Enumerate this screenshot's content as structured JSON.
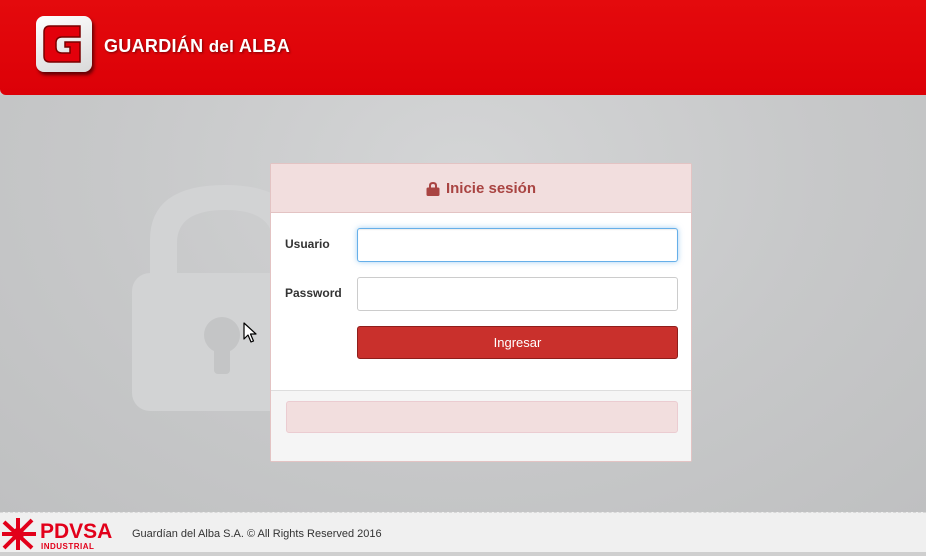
{
  "header": {
    "brand_name": "GUARDIÁN",
    "brand_del": "del",
    "brand_alba": "ALBA",
    "logo_icon": "guardian-g-logo"
  },
  "login": {
    "title": "Inicie sesión",
    "title_icon": "lock-icon",
    "username_label": "Usuario",
    "username_value": "",
    "password_label": "Password",
    "password_value": "",
    "submit_label": "Ingresar",
    "alert_message": ""
  },
  "background": {
    "watermark_icon": "lock-icon"
  },
  "footer": {
    "logo_text": "PDVSA",
    "logo_subtext": "INDUSTRIAL",
    "copyright": "Guardían del Alba S.A. © All Rights Reserved 2016"
  },
  "colors": {
    "header_red": "#e40a0d",
    "panel_heading_bg": "#f2dede",
    "panel_heading_text": "#a94442",
    "button_red": "#c9302c",
    "pdvsa_red": "#e2001a",
    "focus_blue": "#66afe9"
  }
}
